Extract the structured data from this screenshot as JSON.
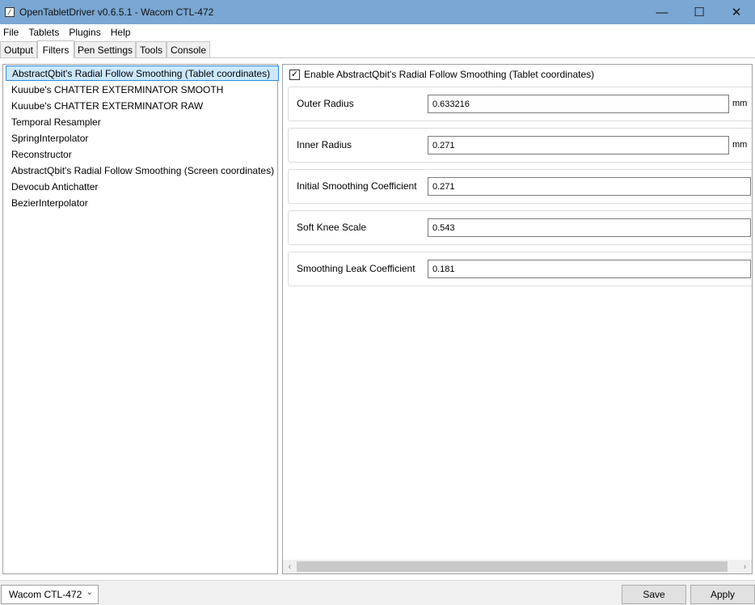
{
  "window": {
    "title": "OpenTabletDriver v0.6.5.1 - Wacom CTL-472",
    "app_icon": "pen-icon",
    "controls": {
      "minimize": "—",
      "maximize": "☐",
      "close": "✕"
    }
  },
  "menu": [
    "File",
    "Tablets",
    "Plugins",
    "Help"
  ],
  "tabs": [
    {
      "label": "Output"
    },
    {
      "label": "Filters",
      "active": true
    },
    {
      "label": "Pen Settings"
    },
    {
      "label": "Tools"
    },
    {
      "label": "Console"
    }
  ],
  "filters": {
    "selected_index": 0,
    "items": [
      "AbstractQbit's Radial Follow Smoothing (Tablet coordinates)",
      "Kuuube's CHATTER EXTERMINATOR SMOOTH",
      "Kuuube's CHATTER EXTERMINATOR RAW",
      "Temporal Resampler",
      "SpringInterpolator",
      "Reconstructor",
      "AbstractQbit's Radial Follow Smoothing (Screen coordinates)",
      "Devocub Antichatter",
      "BezierInterpolator"
    ]
  },
  "settings": {
    "enable_label": "Enable AbstractQbit's Radial Follow Smoothing (Tablet coordinates)",
    "enabled": true,
    "fields": [
      {
        "label": "Outer Radius",
        "value": "0.633216",
        "unit": "mm"
      },
      {
        "label": "Inner Radius",
        "value": "0.271",
        "unit": "mm"
      },
      {
        "label": "Initial Smoothing Coefficient",
        "value": "0.271",
        "unit": ""
      },
      {
        "label": "Soft Knee Scale",
        "value": "0.543",
        "unit": ""
      },
      {
        "label": "Smoothing Leak Coefficient",
        "value": "0.181",
        "unit": ""
      }
    ]
  },
  "scrollbar": {
    "left_arrow": "‹",
    "right_arrow": "›"
  },
  "bottom": {
    "device": "Wacom CTL-472",
    "device_chevron": "⌄",
    "save_label": "Save",
    "apply_label": "Apply"
  },
  "colors": {
    "titlebar": "#7aa7d3",
    "selection_bg": "#cce8ff",
    "selection_border": "#2f8ad8"
  }
}
